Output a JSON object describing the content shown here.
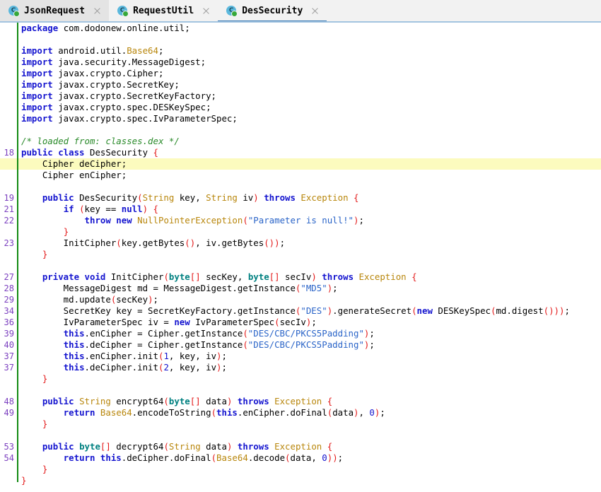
{
  "window": {
    "app": "Jadx Decompiler",
    "accent_color": "#3b7cb5",
    "tabbar_bg": "#f2f2f2",
    "editor_bg": "#ffffff",
    "highlight_color": "#fcfbbe",
    "change_bar_color": "#138a13",
    "line_number_color": "#7b3fbf"
  },
  "tabs": [
    {
      "label": "JsonRequest",
      "icon": "java-class-icon",
      "close_icon": "close-icon",
      "active": false,
      "state": "inactive"
    },
    {
      "label": "RequestUtil",
      "icon": "java-class-icon",
      "close_icon": "close-icon",
      "active": false,
      "state": "plain"
    },
    {
      "label": "DesSecurity",
      "icon": "java-class-icon",
      "close_icon": "close-icon",
      "active": true,
      "state": "active"
    }
  ],
  "editor": {
    "language": "java",
    "filename": "DesSecurity",
    "highlighted_line_index": 11,
    "lines": [
      {
        "num": "",
        "tokens": [
          {
            "t": "package ",
            "c": "kw"
          },
          {
            "t": "com.dodonew.online.util;",
            "c": "pl"
          }
        ]
      },
      {
        "num": "",
        "tokens": []
      },
      {
        "num": "",
        "tokens": [
          {
            "t": "import ",
            "c": "kw"
          },
          {
            "t": "android.util.",
            "c": "pl"
          },
          {
            "t": "Base64",
            "c": "ty"
          },
          {
            "t": ";",
            "c": "pl"
          }
        ]
      },
      {
        "num": "",
        "tokens": [
          {
            "t": "import ",
            "c": "kw"
          },
          {
            "t": "java.security.MessageDigest;",
            "c": "pl"
          }
        ]
      },
      {
        "num": "",
        "tokens": [
          {
            "t": "import ",
            "c": "kw"
          },
          {
            "t": "javax.crypto.Cipher;",
            "c": "pl"
          }
        ]
      },
      {
        "num": "",
        "tokens": [
          {
            "t": "import ",
            "c": "kw"
          },
          {
            "t": "javax.crypto.SecretKey;",
            "c": "pl"
          }
        ]
      },
      {
        "num": "",
        "tokens": [
          {
            "t": "import ",
            "c": "kw"
          },
          {
            "t": "javax.crypto.SecretKeyFactory;",
            "c": "pl"
          }
        ]
      },
      {
        "num": "",
        "tokens": [
          {
            "t": "import ",
            "c": "kw"
          },
          {
            "t": "javax.crypto.spec.DESKeySpec;",
            "c": "pl"
          }
        ]
      },
      {
        "num": "",
        "tokens": [
          {
            "t": "import ",
            "c": "kw"
          },
          {
            "t": "javax.crypto.spec.IvParameterSpec;",
            "c": "pl"
          }
        ]
      },
      {
        "num": "",
        "tokens": []
      },
      {
        "num": "",
        "tokens": [
          {
            "t": "/* loaded from: classes.dex */",
            "c": "cm"
          }
        ]
      },
      {
        "num": "18",
        "tokens": [
          {
            "t": "public class ",
            "c": "kw"
          },
          {
            "t": "DesSecurity ",
            "c": "pl"
          },
          {
            "t": "{",
            "c": "pn"
          }
        ]
      },
      {
        "num": "",
        "tokens": [
          {
            "t": "    Cipher deCipher;",
            "c": "pl"
          }
        ],
        "highlight": true
      },
      {
        "num": "",
        "tokens": [
          {
            "t": "    Cipher enCipher;",
            "c": "pl"
          }
        ]
      },
      {
        "num": "",
        "tokens": []
      },
      {
        "num": "19",
        "tokens": [
          {
            "t": "    ",
            "c": "pl"
          },
          {
            "t": "public ",
            "c": "kw"
          },
          {
            "t": "DesSecurity",
            "c": "pl"
          },
          {
            "t": "(",
            "c": "pn"
          },
          {
            "t": "String ",
            "c": "ty"
          },
          {
            "t": "key, ",
            "c": "pl"
          },
          {
            "t": "String ",
            "c": "ty"
          },
          {
            "t": "iv",
            "c": "pl"
          },
          {
            "t": ")",
            "c": "pn"
          },
          {
            "t": " throws ",
            "c": "kw"
          },
          {
            "t": "Exception ",
            "c": "ty"
          },
          {
            "t": "{",
            "c": "pn"
          }
        ]
      },
      {
        "num": "21",
        "tokens": [
          {
            "t": "        ",
            "c": "pl"
          },
          {
            "t": "if ",
            "c": "kw"
          },
          {
            "t": "(",
            "c": "pn"
          },
          {
            "t": "key == ",
            "c": "pl"
          },
          {
            "t": "null",
            "c": "kw"
          },
          {
            "t": ")",
            "c": "pn"
          },
          {
            "t": " ",
            "c": "pl"
          },
          {
            "t": "{",
            "c": "pn"
          }
        ]
      },
      {
        "num": "22",
        "tokens": [
          {
            "t": "            ",
            "c": "pl"
          },
          {
            "t": "throw new ",
            "c": "kw"
          },
          {
            "t": "NullPointerException",
            "c": "ty"
          },
          {
            "t": "(",
            "c": "pn"
          },
          {
            "t": "\"Parameter is null!\"",
            "c": "str"
          },
          {
            "t": ")",
            "c": "pn"
          },
          {
            "t": ";",
            "c": "pl"
          }
        ]
      },
      {
        "num": "",
        "tokens": [
          {
            "t": "        ",
            "c": "pl"
          },
          {
            "t": "}",
            "c": "pn"
          }
        ]
      },
      {
        "num": "23",
        "tokens": [
          {
            "t": "        InitCipher",
            "c": "pl"
          },
          {
            "t": "(",
            "c": "pn"
          },
          {
            "t": "key.getBytes",
            "c": "pl"
          },
          {
            "t": "()",
            "c": "pn"
          },
          {
            "t": ", iv.getBytes",
            "c": "pl"
          },
          {
            "t": "())",
            "c": "pn"
          },
          {
            "t": ";",
            "c": "pl"
          }
        ]
      },
      {
        "num": "",
        "tokens": [
          {
            "t": "    ",
            "c": "pl"
          },
          {
            "t": "}",
            "c": "pn"
          }
        ]
      },
      {
        "num": "",
        "tokens": []
      },
      {
        "num": "27",
        "tokens": [
          {
            "t": "    ",
            "c": "pl"
          },
          {
            "t": "private void ",
            "c": "kw"
          },
          {
            "t": "InitCipher",
            "c": "pl"
          },
          {
            "t": "(",
            "c": "pn"
          },
          {
            "t": "byte",
            "c": "pr"
          },
          {
            "t": "[]",
            "c": "pn"
          },
          {
            "t": " secKey, ",
            "c": "pl"
          },
          {
            "t": "byte",
            "c": "pr"
          },
          {
            "t": "[]",
            "c": "pn"
          },
          {
            "t": " secIv",
            "c": "pl"
          },
          {
            "t": ")",
            "c": "pn"
          },
          {
            "t": " throws ",
            "c": "kw"
          },
          {
            "t": "Exception ",
            "c": "ty"
          },
          {
            "t": "{",
            "c": "pn"
          }
        ]
      },
      {
        "num": "28",
        "tokens": [
          {
            "t": "        MessageDigest md = MessageDigest.getInstance",
            "c": "pl"
          },
          {
            "t": "(",
            "c": "pn"
          },
          {
            "t": "\"MD5\"",
            "c": "str"
          },
          {
            "t": ")",
            "c": "pn"
          },
          {
            "t": ";",
            "c": "pl"
          }
        ]
      },
      {
        "num": "29",
        "tokens": [
          {
            "t": "        md.update",
            "c": "pl"
          },
          {
            "t": "(",
            "c": "pn"
          },
          {
            "t": "secKey",
            "c": "pl"
          },
          {
            "t": ")",
            "c": "pn"
          },
          {
            "t": ";",
            "c": "pl"
          }
        ]
      },
      {
        "num": "34",
        "tokens": [
          {
            "t": "        SecretKey key = SecretKeyFactory.getInstance",
            "c": "pl"
          },
          {
            "t": "(",
            "c": "pn"
          },
          {
            "t": "\"DES\"",
            "c": "str"
          },
          {
            "t": ")",
            "c": "pn"
          },
          {
            "t": ".generateSecret",
            "c": "pl"
          },
          {
            "t": "(",
            "c": "pn"
          },
          {
            "t": "new ",
            "c": "kw"
          },
          {
            "t": "DESKeySpec",
            "c": "pl"
          },
          {
            "t": "(",
            "c": "pn"
          },
          {
            "t": "md.digest",
            "c": "pl"
          },
          {
            "t": "()))",
            "c": "pn"
          },
          {
            "t": ";",
            "c": "pl"
          }
        ]
      },
      {
        "num": "36",
        "tokens": [
          {
            "t": "        IvParameterSpec iv = ",
            "c": "pl"
          },
          {
            "t": "new ",
            "c": "kw"
          },
          {
            "t": "IvParameterSpec",
            "c": "pl"
          },
          {
            "t": "(",
            "c": "pn"
          },
          {
            "t": "secIv",
            "c": "pl"
          },
          {
            "t": ")",
            "c": "pn"
          },
          {
            "t": ";",
            "c": "pl"
          }
        ]
      },
      {
        "num": "39",
        "tokens": [
          {
            "t": "        ",
            "c": "pl"
          },
          {
            "t": "this",
            "c": "th"
          },
          {
            "t": ".enCipher = Cipher.getInstance",
            "c": "pl"
          },
          {
            "t": "(",
            "c": "pn"
          },
          {
            "t": "\"DES/CBC/PKCS5Padding\"",
            "c": "str"
          },
          {
            "t": ")",
            "c": "pn"
          },
          {
            "t": ";",
            "c": "pl"
          }
        ]
      },
      {
        "num": "40",
        "tokens": [
          {
            "t": "        ",
            "c": "pl"
          },
          {
            "t": "this",
            "c": "th"
          },
          {
            "t": ".deCipher = Cipher.getInstance",
            "c": "pl"
          },
          {
            "t": "(",
            "c": "pn"
          },
          {
            "t": "\"DES/CBC/PKCS5Padding\"",
            "c": "str"
          },
          {
            "t": ")",
            "c": "pn"
          },
          {
            "t": ";",
            "c": "pl"
          }
        ]
      },
      {
        "num": "37",
        "tokens": [
          {
            "t": "        ",
            "c": "pl"
          },
          {
            "t": "this",
            "c": "th"
          },
          {
            "t": ".enCipher.init",
            "c": "pl"
          },
          {
            "t": "(",
            "c": "pn"
          },
          {
            "t": "1",
            "c": "num"
          },
          {
            "t": ", key, iv",
            "c": "pl"
          },
          {
            "t": ")",
            "c": "pn"
          },
          {
            "t": ";",
            "c": "pl"
          }
        ]
      },
      {
        "num": "37",
        "tokens": [
          {
            "t": "        ",
            "c": "pl"
          },
          {
            "t": "this",
            "c": "th"
          },
          {
            "t": ".deCipher.init",
            "c": "pl"
          },
          {
            "t": "(",
            "c": "pn"
          },
          {
            "t": "2",
            "c": "num"
          },
          {
            "t": ", key, iv",
            "c": "pl"
          },
          {
            "t": ")",
            "c": "pn"
          },
          {
            "t": ";",
            "c": "pl"
          }
        ]
      },
      {
        "num": "",
        "tokens": [
          {
            "t": "    ",
            "c": "pl"
          },
          {
            "t": "}",
            "c": "pn"
          }
        ]
      },
      {
        "num": "",
        "tokens": []
      },
      {
        "num": "48",
        "tokens": [
          {
            "t": "    ",
            "c": "pl"
          },
          {
            "t": "public ",
            "c": "kw"
          },
          {
            "t": "String ",
            "c": "ty"
          },
          {
            "t": "encrypt64",
            "c": "pl"
          },
          {
            "t": "(",
            "c": "pn"
          },
          {
            "t": "byte",
            "c": "pr"
          },
          {
            "t": "[]",
            "c": "pn"
          },
          {
            "t": " data",
            "c": "pl"
          },
          {
            "t": ")",
            "c": "pn"
          },
          {
            "t": " throws ",
            "c": "kw"
          },
          {
            "t": "Exception ",
            "c": "ty"
          },
          {
            "t": "{",
            "c": "pn"
          }
        ]
      },
      {
        "num": "49",
        "tokens": [
          {
            "t": "        ",
            "c": "pl"
          },
          {
            "t": "return ",
            "c": "kw"
          },
          {
            "t": "Base64",
            "c": "ty"
          },
          {
            "t": ".encodeToString",
            "c": "pl"
          },
          {
            "t": "(",
            "c": "pn"
          },
          {
            "t": "this",
            "c": "th"
          },
          {
            "t": ".enCipher.doFinal",
            "c": "pl"
          },
          {
            "t": "(",
            "c": "pn"
          },
          {
            "t": "data",
            "c": "pl"
          },
          {
            "t": ")",
            "c": "pn"
          },
          {
            "t": ", ",
            "c": "pl"
          },
          {
            "t": "0",
            "c": "num"
          },
          {
            "t": ")",
            "c": "pn"
          },
          {
            "t": ";",
            "c": "pl"
          }
        ]
      },
      {
        "num": "",
        "tokens": [
          {
            "t": "    ",
            "c": "pl"
          },
          {
            "t": "}",
            "c": "pn"
          }
        ]
      },
      {
        "num": "",
        "tokens": []
      },
      {
        "num": "53",
        "tokens": [
          {
            "t": "    ",
            "c": "pl"
          },
          {
            "t": "public ",
            "c": "kw"
          },
          {
            "t": "byte",
            "c": "pr"
          },
          {
            "t": "[]",
            "c": "pn"
          },
          {
            "t": " decrypt64",
            "c": "pl"
          },
          {
            "t": "(",
            "c": "pn"
          },
          {
            "t": "String ",
            "c": "ty"
          },
          {
            "t": "data",
            "c": "pl"
          },
          {
            "t": ")",
            "c": "pn"
          },
          {
            "t": " throws ",
            "c": "kw"
          },
          {
            "t": "Exception ",
            "c": "ty"
          },
          {
            "t": "{",
            "c": "pn"
          }
        ]
      },
      {
        "num": "54",
        "tokens": [
          {
            "t": "        ",
            "c": "pl"
          },
          {
            "t": "return ",
            "c": "kw"
          },
          {
            "t": "this",
            "c": "th"
          },
          {
            "t": ".deCipher.doFinal",
            "c": "pl"
          },
          {
            "t": "(",
            "c": "pn"
          },
          {
            "t": "Base64",
            "c": "ty"
          },
          {
            "t": ".decode",
            "c": "pl"
          },
          {
            "t": "(",
            "c": "pn"
          },
          {
            "t": "data, ",
            "c": "pl"
          },
          {
            "t": "0",
            "c": "num"
          },
          {
            "t": "))",
            "c": "pn"
          },
          {
            "t": ";",
            "c": "pl"
          }
        ]
      },
      {
        "num": "",
        "tokens": [
          {
            "t": "    ",
            "c": "pl"
          },
          {
            "t": "}",
            "c": "pn"
          }
        ]
      },
      {
        "num": "",
        "tokens": [
          {
            "t": "}",
            "c": "pn"
          }
        ]
      }
    ]
  }
}
